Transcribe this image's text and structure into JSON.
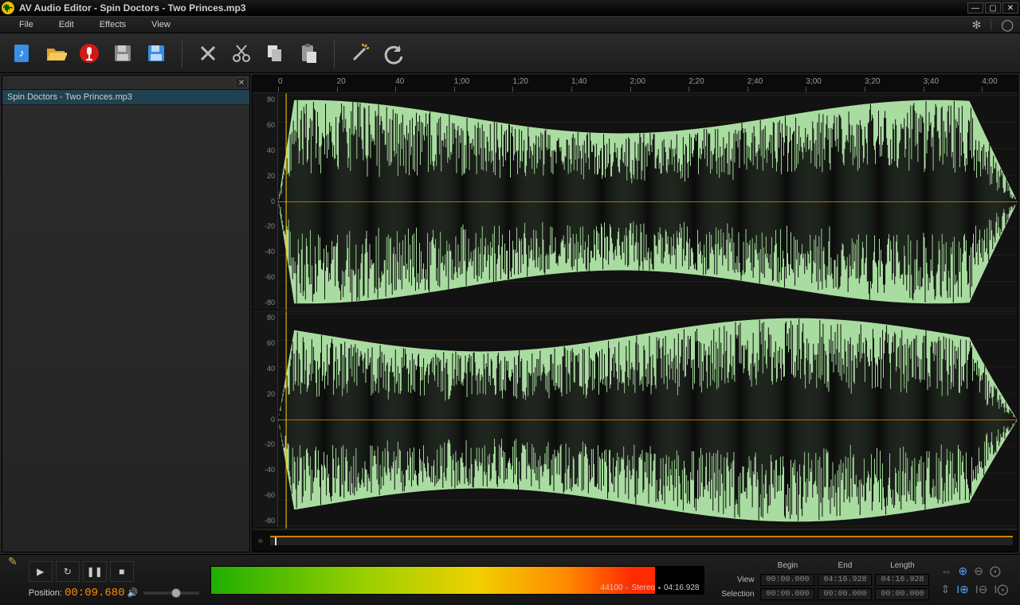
{
  "titlebar": {
    "title": "AV Audio Editor - Spin Doctors - Two Princes.mp3"
  },
  "menubar": {
    "items": [
      "File",
      "Edit",
      "Effects",
      "View"
    ]
  },
  "toolbar_icons": [
    "new-audio",
    "open-file",
    "record",
    "save",
    "save-as",
    "delete",
    "cut",
    "copy",
    "paste",
    "magic",
    "undo"
  ],
  "sidebar": {
    "items": [
      "Spin Doctors - Two Princes.mp3"
    ]
  },
  "ruler": {
    "labels": [
      "0",
      "20",
      "40",
      "1;00",
      "1;20",
      "1;40",
      "2;00",
      "2;20",
      "2;40",
      "3;00",
      "3;20",
      "3;40",
      "4;00"
    ]
  },
  "amplitude_labels": [
    "80",
    "60",
    "40",
    "20",
    "0",
    "-20",
    "-40",
    "-60",
    "-80"
  ],
  "position": {
    "label": "Position:",
    "value": "00:09.680"
  },
  "level_meter": {
    "sample_rate": "44100",
    "mode": "Stereo",
    "duration": "04:16.928"
  },
  "selection": {
    "headers": [
      "Begin",
      "End",
      "Length"
    ],
    "rows": {
      "View": [
        "00:00.000",
        "04:16.928",
        "04:16.928"
      ],
      "Selection": [
        "00:00.000",
        "00:00.000",
        "00:00.000"
      ]
    }
  }
}
